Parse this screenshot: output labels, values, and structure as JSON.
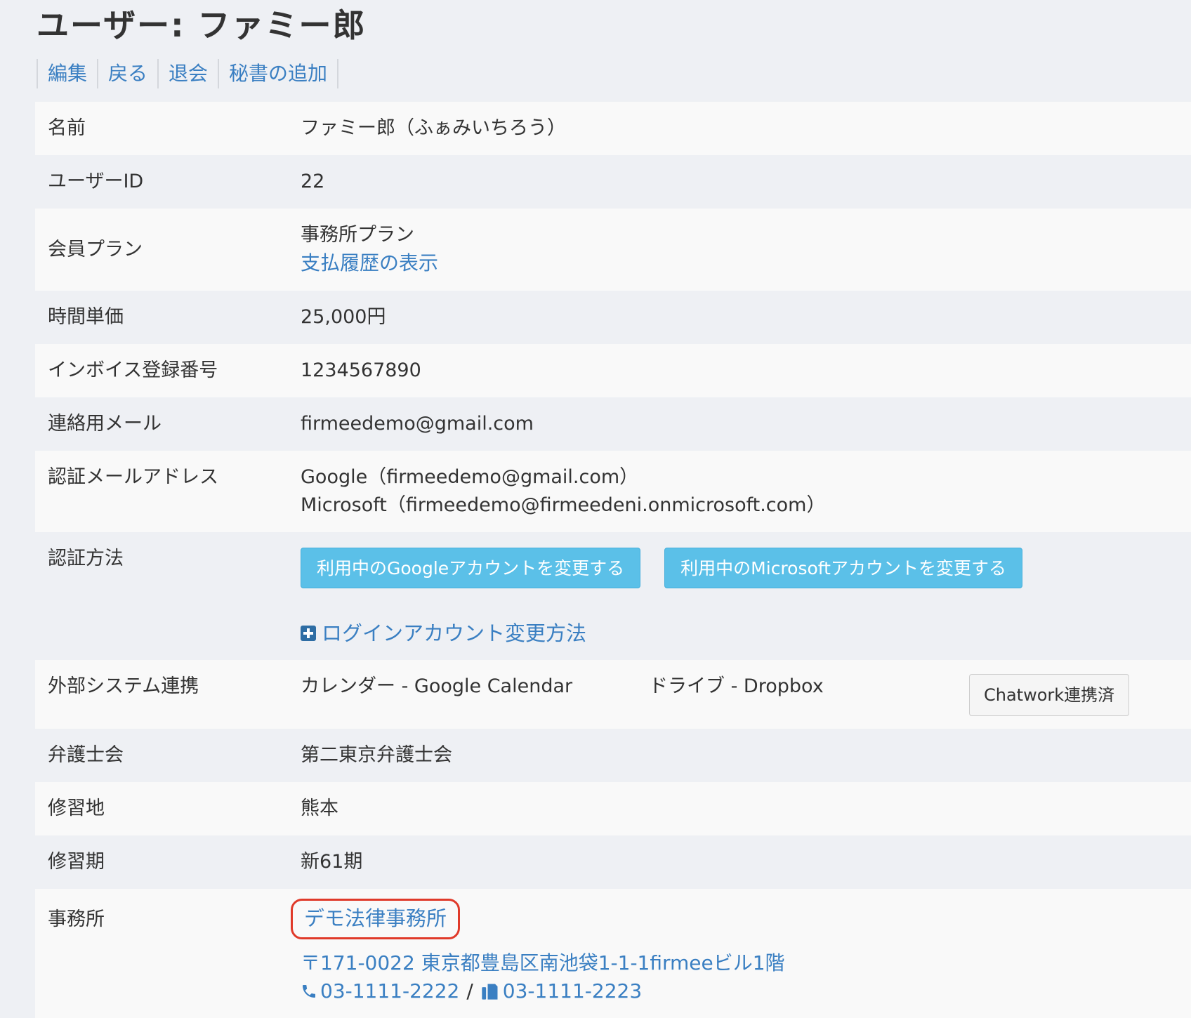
{
  "page": {
    "title": "ユーザー: ファミー郎"
  },
  "actions": {
    "edit": "編集",
    "back": "戻る",
    "withdraw": "退会",
    "add_secretary": "秘書の追加"
  },
  "rows": {
    "name": {
      "label": "名前",
      "value": "ファミー郎（ふぁみいちろう）"
    },
    "user_id": {
      "label": "ユーザーID",
      "value": "22"
    },
    "plan": {
      "label": "会員プラン",
      "value": "事務所プラン",
      "link": "支払履歴の表示"
    },
    "hourly_rate": {
      "label": "時間単価",
      "value": "25,000円"
    },
    "invoice_number": {
      "label": "インボイス登録番号",
      "value": "1234567890"
    },
    "contact_email": {
      "label": "連絡用メール",
      "value": "firmeedemo@gmail.com"
    },
    "auth_email": {
      "label": "認証メールアドレス",
      "google": "Google（firmeedemo@gmail.com）",
      "microsoft": "Microsoft（firmeedemo@firmeedeni.onmicrosoft.com）"
    },
    "auth_method": {
      "label": "認証方法",
      "google_button": "利用中のGoogleアカウントを変更する",
      "microsoft_button": "利用中のMicrosoftアカウントを変更する",
      "help_link": "ログインアカウント変更方法"
    },
    "external": {
      "label": "外部システム連携",
      "calendar": "カレンダー - Google Calendar",
      "drive": "ドライブ - Dropbox",
      "chatwork_button": "Chatwork連携済"
    },
    "bar_association": {
      "label": "弁護士会",
      "value": "第二東京弁護士会"
    },
    "training_place": {
      "label": "修習地",
      "value": "熊本"
    },
    "training_term": {
      "label": "修習期",
      "value": "新61期"
    },
    "office": {
      "label": "事務所",
      "name": "デモ法律事務所",
      "address": "〒171-0022 東京都豊島区南池袋1-1-1firmeeビル1階",
      "tel": "03-1111-2222",
      "separator": "/",
      "fax": "03-1111-2223"
    }
  },
  "icons": {
    "help": "plus-square-icon",
    "tel": "phone-icon",
    "fax": "fax-icon"
  },
  "colors": {
    "link": "#3a7fc2",
    "primary_button": "#5bc0e8",
    "highlight_border": "#e03a2a",
    "background": "#eef0f4",
    "row_stripe": "#f9f9f9"
  }
}
